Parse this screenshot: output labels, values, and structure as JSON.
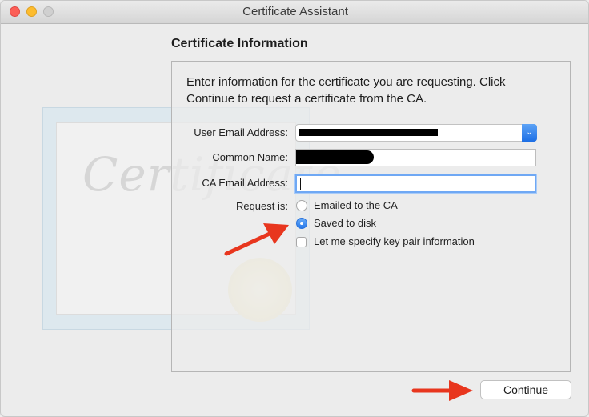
{
  "window": {
    "title": "Certificate Assistant"
  },
  "heading": "Certificate Information",
  "description": "Enter information for the certificate you are requesting. Click Continue to request a certificate from the CA.",
  "form": {
    "user_email_label": "User Email Address:",
    "common_name_label": "Common Name:",
    "ca_email_label": "CA Email Address:",
    "ca_email_value": "",
    "request_label": "Request is:",
    "options": [
      {
        "label": "Emailed to the CA",
        "selected": false
      },
      {
        "label": "Saved to disk",
        "selected": true
      }
    ],
    "key_pair_label": "Let me specify key pair information",
    "key_pair_checked": false
  },
  "background_art": {
    "word": "Certificate"
  },
  "buttons": {
    "continue": "Continue"
  },
  "colors": {
    "accent": "#2678ea",
    "annotation_arrow": "#e8361e"
  }
}
